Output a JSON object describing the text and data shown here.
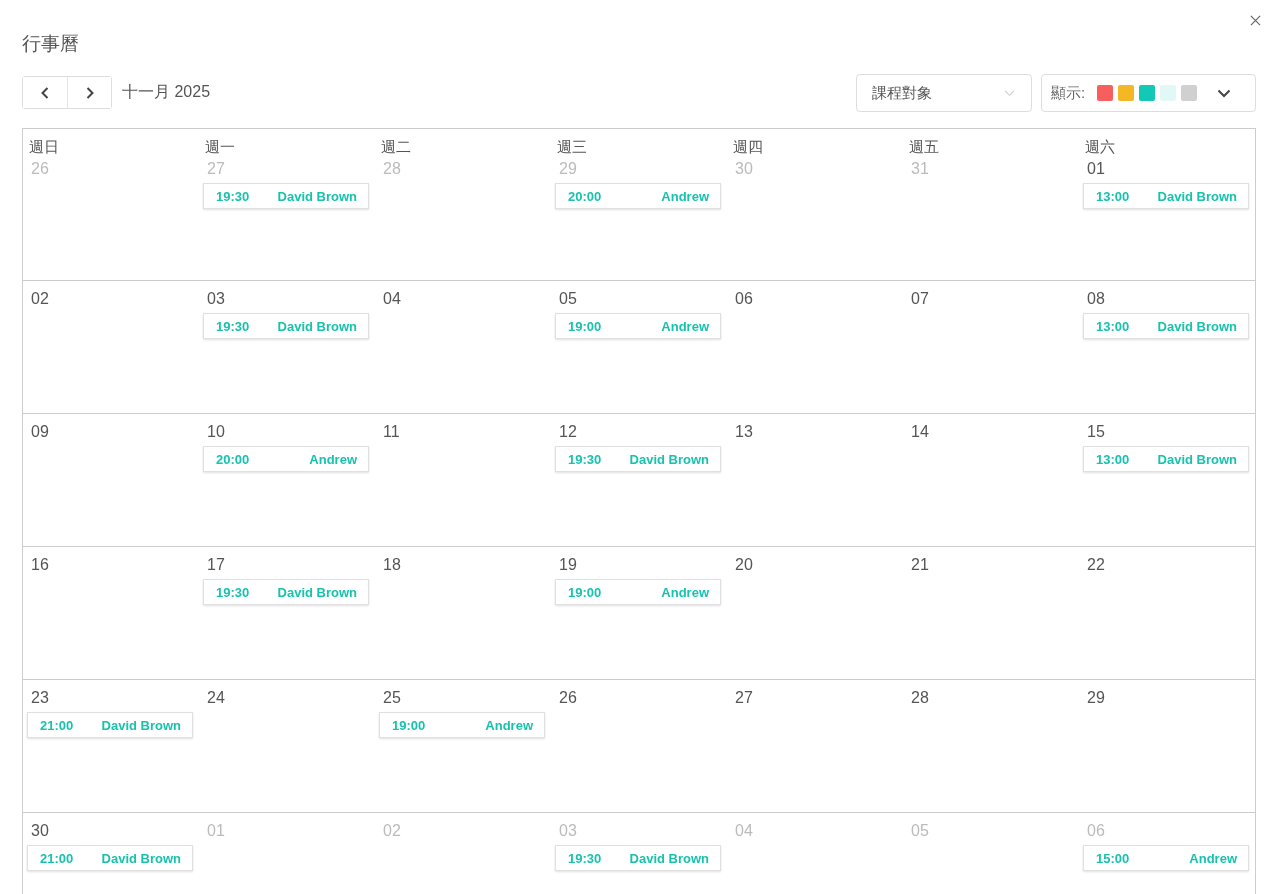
{
  "title": "行事曆",
  "month_label": "十一月 2025",
  "filter": {
    "placeholder": "課程對象"
  },
  "display": {
    "label": "顯示:",
    "swatches": [
      {
        "color": "#f75e5e"
      },
      {
        "color": "#f4b826"
      },
      {
        "color": "#13c8b5"
      },
      {
        "color": "#e2f8f6"
      },
      {
        "color": "#d0d0d0"
      }
    ]
  },
  "weekdays": [
    "週日",
    "週一",
    "週二",
    "週三",
    "週四",
    "週五",
    "週六"
  ],
  "weeks": [
    [
      {
        "date": "26",
        "outside_month": true
      },
      {
        "date": "27",
        "outside_month": true,
        "events": [
          {
            "time": "19:30",
            "name": "David Brown"
          }
        ]
      },
      {
        "date": "28",
        "outside_month": true
      },
      {
        "date": "29",
        "outside_month": true,
        "events": [
          {
            "time": "20:00",
            "name": "Andrew"
          }
        ]
      },
      {
        "date": "30",
        "outside_month": true
      },
      {
        "date": "31",
        "outside_month": true
      },
      {
        "date": "01",
        "outside_month": false,
        "events": [
          {
            "time": "13:00",
            "name": "David Brown"
          }
        ]
      }
    ],
    [
      {
        "date": "02",
        "outside_month": false
      },
      {
        "date": "03",
        "outside_month": false,
        "events": [
          {
            "time": "19:30",
            "name": "David Brown"
          }
        ]
      },
      {
        "date": "04",
        "outside_month": false
      },
      {
        "date": "05",
        "outside_month": false,
        "events": [
          {
            "time": "19:00",
            "name": "Andrew"
          }
        ]
      },
      {
        "date": "06",
        "outside_month": false
      },
      {
        "date": "07",
        "outside_month": false
      },
      {
        "date": "08",
        "outside_month": false,
        "events": [
          {
            "time": "13:00",
            "name": "David Brown"
          }
        ]
      }
    ],
    [
      {
        "date": "09",
        "outside_month": false
      },
      {
        "date": "10",
        "outside_month": false,
        "events": [
          {
            "time": "20:00",
            "name": "Andrew"
          }
        ]
      },
      {
        "date": "11",
        "outside_month": false
      },
      {
        "date": "12",
        "outside_month": false,
        "events": [
          {
            "time": "19:30",
            "name": "David Brown"
          }
        ]
      },
      {
        "date": "13",
        "outside_month": false
      },
      {
        "date": "14",
        "outside_month": false
      },
      {
        "date": "15",
        "outside_month": false,
        "events": [
          {
            "time": "13:00",
            "name": "David Brown"
          }
        ]
      }
    ],
    [
      {
        "date": "16",
        "outside_month": false
      },
      {
        "date": "17",
        "outside_month": false,
        "events": [
          {
            "time": "19:30",
            "name": "David Brown"
          }
        ]
      },
      {
        "date": "18",
        "outside_month": false
      },
      {
        "date": "19",
        "outside_month": false,
        "events": [
          {
            "time": "19:00",
            "name": "Andrew"
          }
        ]
      },
      {
        "date": "20",
        "outside_month": false
      },
      {
        "date": "21",
        "outside_month": false
      },
      {
        "date": "22",
        "outside_month": false
      }
    ],
    [
      {
        "date": "23",
        "outside_month": false,
        "events": [
          {
            "time": "21:00",
            "name": "David Brown"
          }
        ]
      },
      {
        "date": "24",
        "outside_month": false
      },
      {
        "date": "25",
        "outside_month": false,
        "events": [
          {
            "time": "19:00",
            "name": "Andrew"
          }
        ]
      },
      {
        "date": "26",
        "outside_month": false
      },
      {
        "date": "27",
        "outside_month": false
      },
      {
        "date": "28",
        "outside_month": false
      },
      {
        "date": "29",
        "outside_month": false
      }
    ],
    [
      {
        "date": "30",
        "outside_month": false,
        "events": [
          {
            "time": "21:00",
            "name": "David Brown"
          }
        ]
      },
      {
        "date": "01",
        "outside_month": true
      },
      {
        "date": "02",
        "outside_month": true
      },
      {
        "date": "03",
        "outside_month": true,
        "events": [
          {
            "time": "19:30",
            "name": "David Brown"
          }
        ]
      },
      {
        "date": "04",
        "outside_month": true
      },
      {
        "date": "05",
        "outside_month": true
      },
      {
        "date": "06",
        "outside_month": true,
        "events": [
          {
            "time": "15:00",
            "name": "Andrew"
          }
        ]
      }
    ]
  ]
}
